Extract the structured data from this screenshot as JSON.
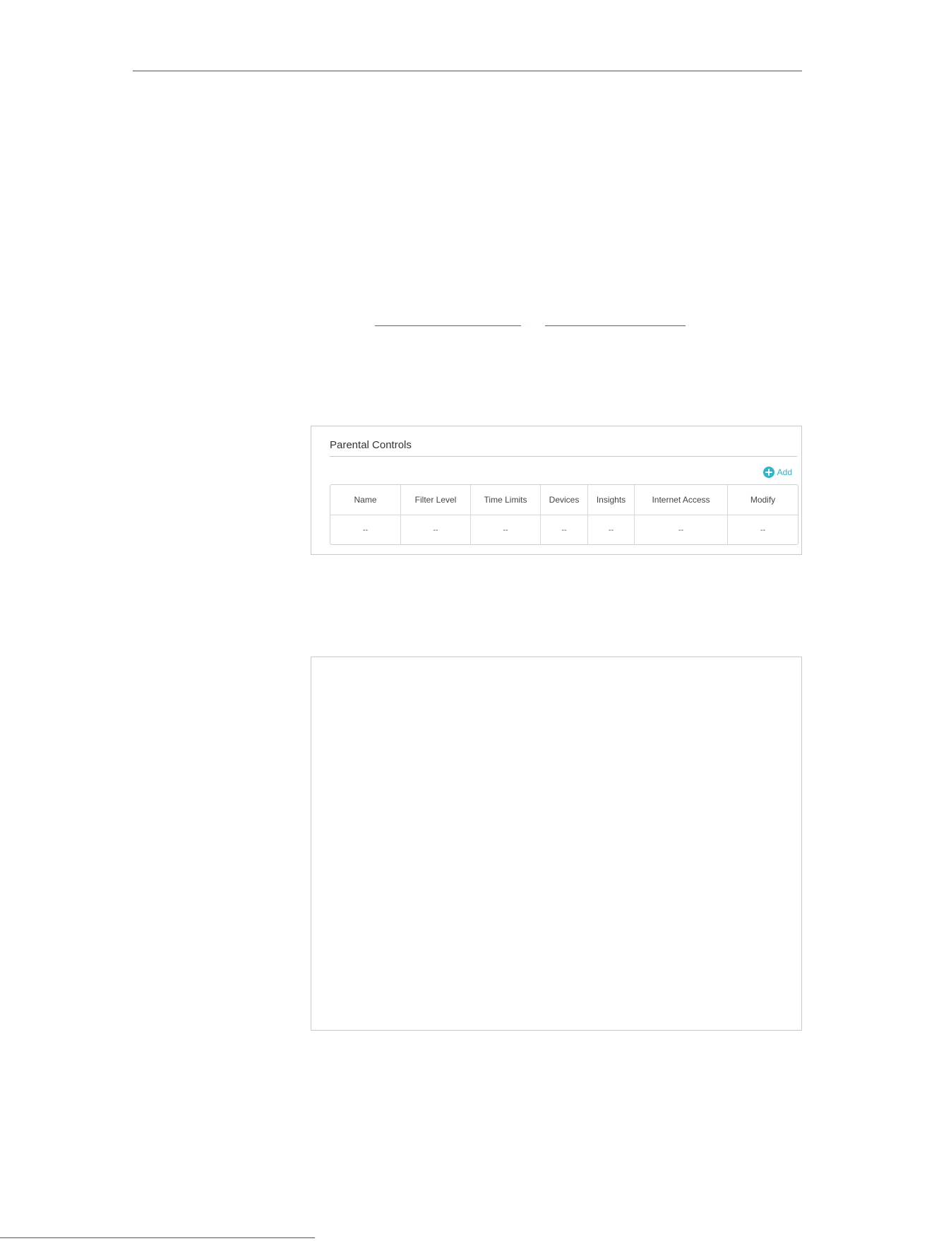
{
  "panel": {
    "title": "Parental Controls",
    "add_label": "Add",
    "accent_color": "#2fb4c8",
    "columns": [
      "Name",
      "Filter Level",
      "Time Limits",
      "Devices",
      "Insights",
      "Internet Access",
      "Modify"
    ],
    "rows": [
      [
        "--",
        "--",
        "--",
        "--",
        "--",
        "--",
        "--"
      ]
    ]
  }
}
